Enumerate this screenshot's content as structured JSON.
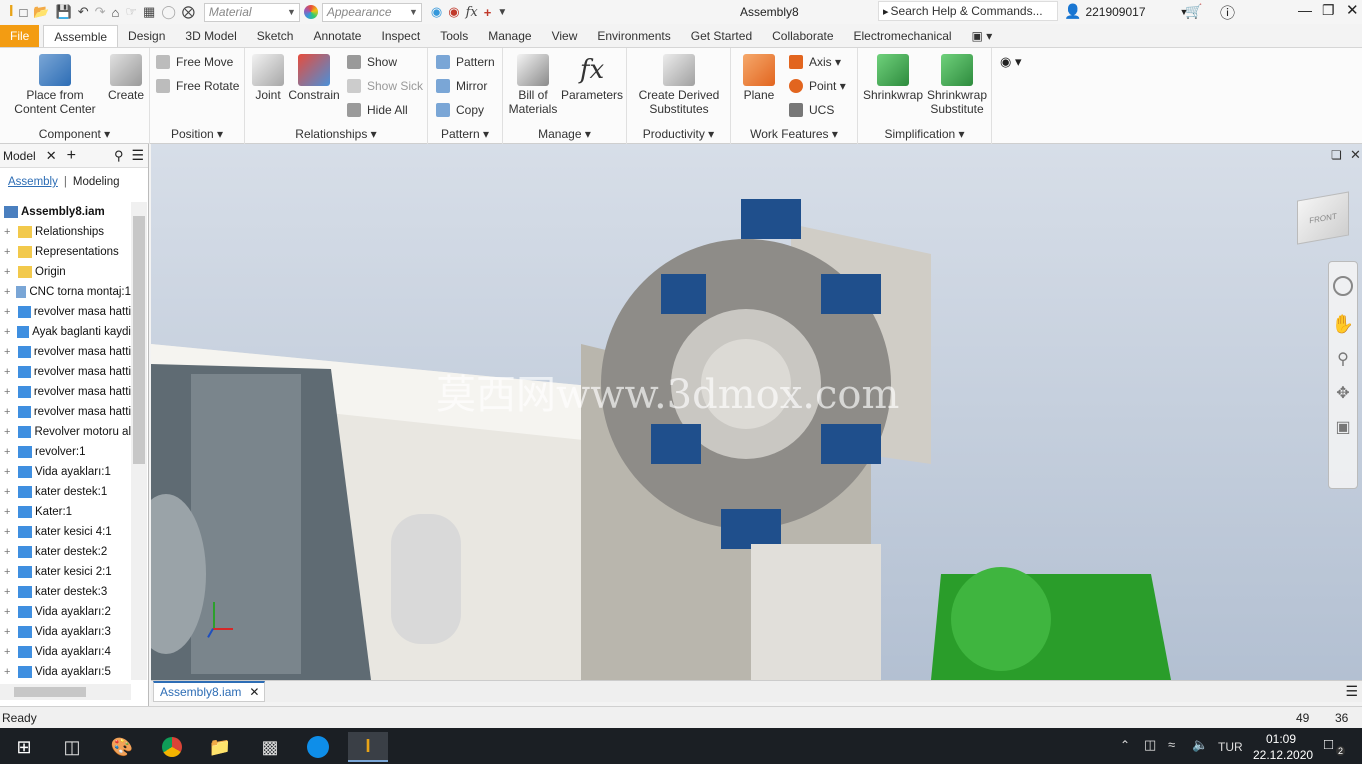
{
  "window": {
    "title": "Assembly8",
    "search_placeholder": "Search Help & Commands...",
    "user": "221909017"
  },
  "quick_access": {
    "material": "Material",
    "appearance": "Appearance"
  },
  "tabs": [
    "File",
    "Assemble",
    "Design",
    "3D Model",
    "Sketch",
    "Annotate",
    "Inspect",
    "Tools",
    "Manage",
    "View",
    "Environments",
    "Get Started",
    "Collaborate",
    "Electromechanical"
  ],
  "ribbon": {
    "component": {
      "label": "Component",
      "place": "Place from\nContent Center",
      "create": "Create"
    },
    "position": {
      "label": "Position",
      "free_move": "Free Move",
      "free_rotate": "Free Rotate"
    },
    "relationships": {
      "label": "Relationships",
      "joint": "Joint",
      "constrain": "Constrain",
      "show": "Show",
      "show_sick": "Show Sick",
      "hide_all": "Hide All"
    },
    "pattern": {
      "label": "Pattern",
      "pattern": "Pattern",
      "mirror": "Mirror",
      "copy": "Copy"
    },
    "manage": {
      "label": "Manage",
      "bom": "Bill of\nMaterials",
      "parameters": "Parameters"
    },
    "productivity": {
      "label": "Productivity",
      "derived": "Create Derived\nSubstitutes"
    },
    "work_features": {
      "label": "Work Features",
      "plane": "Plane",
      "axis": "Axis",
      "point": "Point",
      "ucs": "UCS"
    },
    "simplification": {
      "label": "Simplification",
      "shrinkwrap": "Shrinkwrap",
      "shrinkwrap_sub": "Shrinkwrap\nSubstitute"
    }
  },
  "browser": {
    "title": "Model",
    "tab_assembly": "Assembly",
    "tab_modeling": "Modeling",
    "root": "Assembly8.iam",
    "items": [
      "Relationships",
      "Representations",
      "Origin",
      "CNC torna montaj:1",
      "revolver masa hatti",
      "Ayak baglanti kaydi",
      "revolver masa hatti",
      "revolver masa hatti",
      "revolver masa hatti",
      "revolver masa hatti",
      "Revolver motoru al",
      "revolver:1",
      "Vida ayakları:1",
      "kater destek:1",
      "Kater:1",
      "kater kesici 4:1",
      "kater destek:2",
      "kater kesici 2:1",
      "kater destek:3",
      "Vida ayakları:2",
      "Vida ayakları:3",
      "Vida ayakları:4",
      "Vida ayakları:5"
    ]
  },
  "viewport": {
    "watermark": "莫西网www.3dmox.com",
    "viewcube_label": "FRONT"
  },
  "doc_tab": "Assembly8.iam",
  "status": {
    "text": "Ready",
    "num1": "49",
    "num2": "36"
  },
  "taskbar": {
    "lang": "TUR",
    "time": "01:09",
    "date": "22.12.2020",
    "notif": "2"
  }
}
